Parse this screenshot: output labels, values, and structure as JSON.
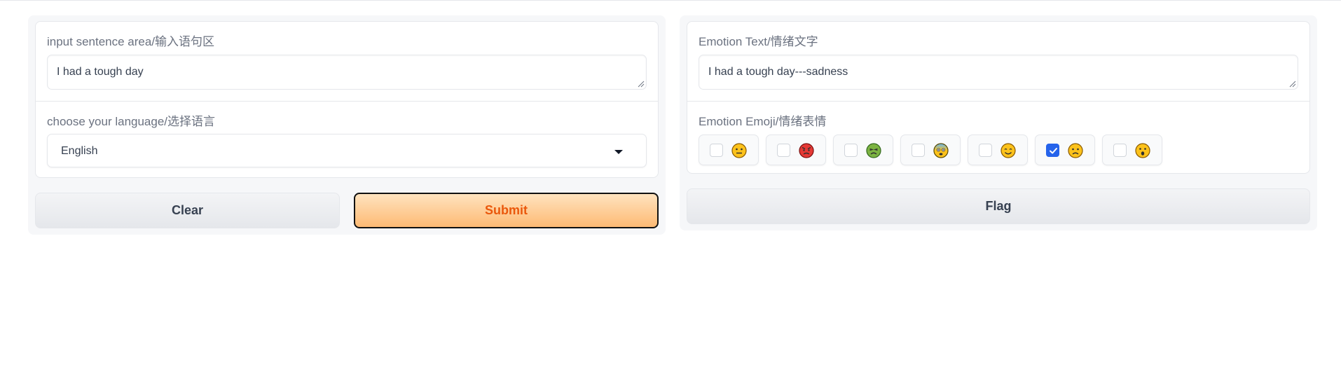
{
  "input": {
    "label": "input sentence area/输入语句区",
    "value": "I had a tough day"
  },
  "language": {
    "label": "choose your language/选择语言",
    "selected": "English"
  },
  "buttons": {
    "clear": "Clear",
    "submit": "Submit",
    "flag": "Flag"
  },
  "output": {
    "text_label": "Emotion Text/情绪文字",
    "text_value": "I had a tough day---sadness",
    "emoji_label": "Emotion Emoji/情绪表情"
  },
  "emojis": [
    {
      "icon": "neutral-face-icon",
      "checked": false
    },
    {
      "icon": "angry-face-icon",
      "checked": false
    },
    {
      "icon": "nauseated-face-icon",
      "checked": false
    },
    {
      "icon": "fearful-face-icon",
      "checked": false
    },
    {
      "icon": "smiling-face-icon",
      "checked": false
    },
    {
      "icon": "sad-face-icon",
      "checked": true
    },
    {
      "icon": "surprised-face-icon",
      "checked": false
    }
  ],
  "colors": {
    "submit_text": "#ea580c",
    "checkbox_checked": "#2563eb"
  }
}
